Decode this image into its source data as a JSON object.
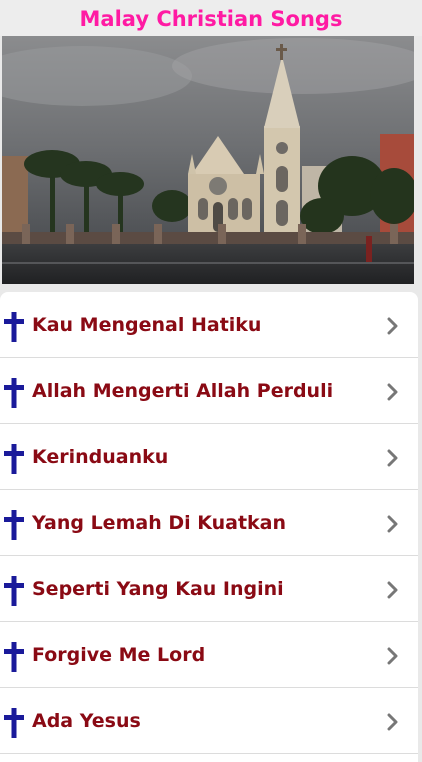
{
  "app": {
    "title": "Malay Christian Songs",
    "title_color": "#ff1aa3"
  },
  "banner": {
    "image": "church-photo"
  },
  "colors": {
    "item_text": "#8a0a14",
    "cross": "#1a1a9a",
    "chevron": "#777777"
  },
  "songs": [
    {
      "label": "Kau Mengenal Hatiku",
      "icon": "cross-icon"
    },
    {
      "label": "Allah Mengerti Allah Perduli",
      "icon": "cross-icon"
    },
    {
      "label": "Kerinduanku",
      "icon": "cross-icon"
    },
    {
      "label": "Yang Lemah Di Kuatkan",
      "icon": "cross-icon"
    },
    {
      "label": "Seperti Yang Kau Ingini",
      "icon": "cross-icon"
    },
    {
      "label": "Forgive Me Lord",
      "icon": "cross-icon"
    },
    {
      "label": "Ada Yesus",
      "icon": "cross-icon"
    }
  ]
}
